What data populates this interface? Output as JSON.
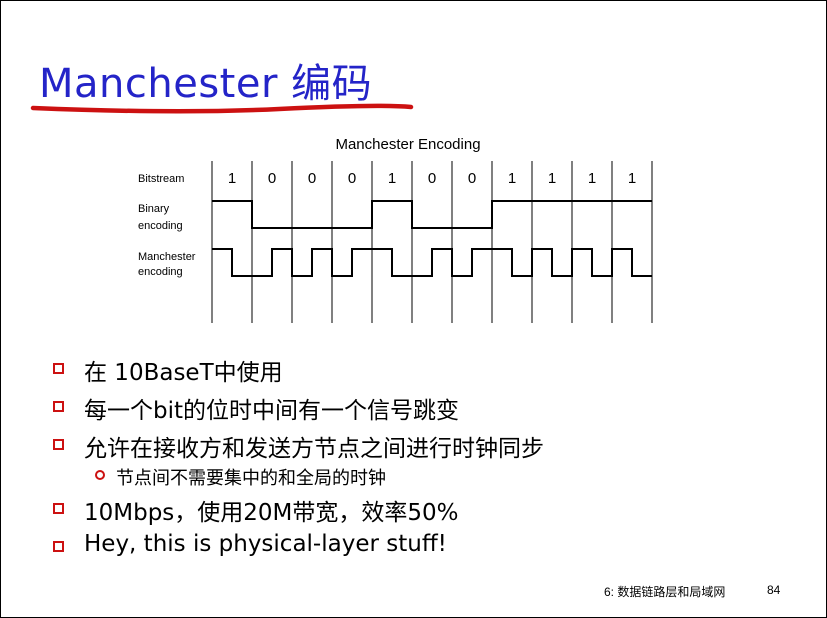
{
  "title": "Manchester 编码",
  "diagram": {
    "heading": "Manchester Encoding",
    "row_labels": {
      "bitstream": "Bitstream",
      "binary": [
        "Binary",
        "encoding"
      ],
      "manchester": [
        "Manchester",
        "encoding"
      ]
    },
    "bits": [
      "1",
      "0",
      "0",
      "0",
      "1",
      "0",
      "0",
      "1",
      "1",
      "1",
      "1"
    ]
  },
  "bullets": [
    {
      "text": "在 10BaseT中使用"
    },
    {
      "text": "每一个bit的位时中间有一个信号跳变"
    },
    {
      "text": "允许在接收方和发送方节点之间进行时钟同步"
    },
    {
      "text": "10Mbps，使用20M带宽，效率50%"
    },
    {
      "text": "Hey, this is physical-layer stuff!"
    }
  ],
  "sub_bullet": {
    "text": "节点间不需要集中的和全局的时钟"
  },
  "footer": {
    "chapter": "6: 数据链路层和局域网",
    "page": "84"
  },
  "colors": {
    "title": "#2424c8",
    "underline": "#cc1111",
    "bullet_marker": "#cc1111"
  }
}
